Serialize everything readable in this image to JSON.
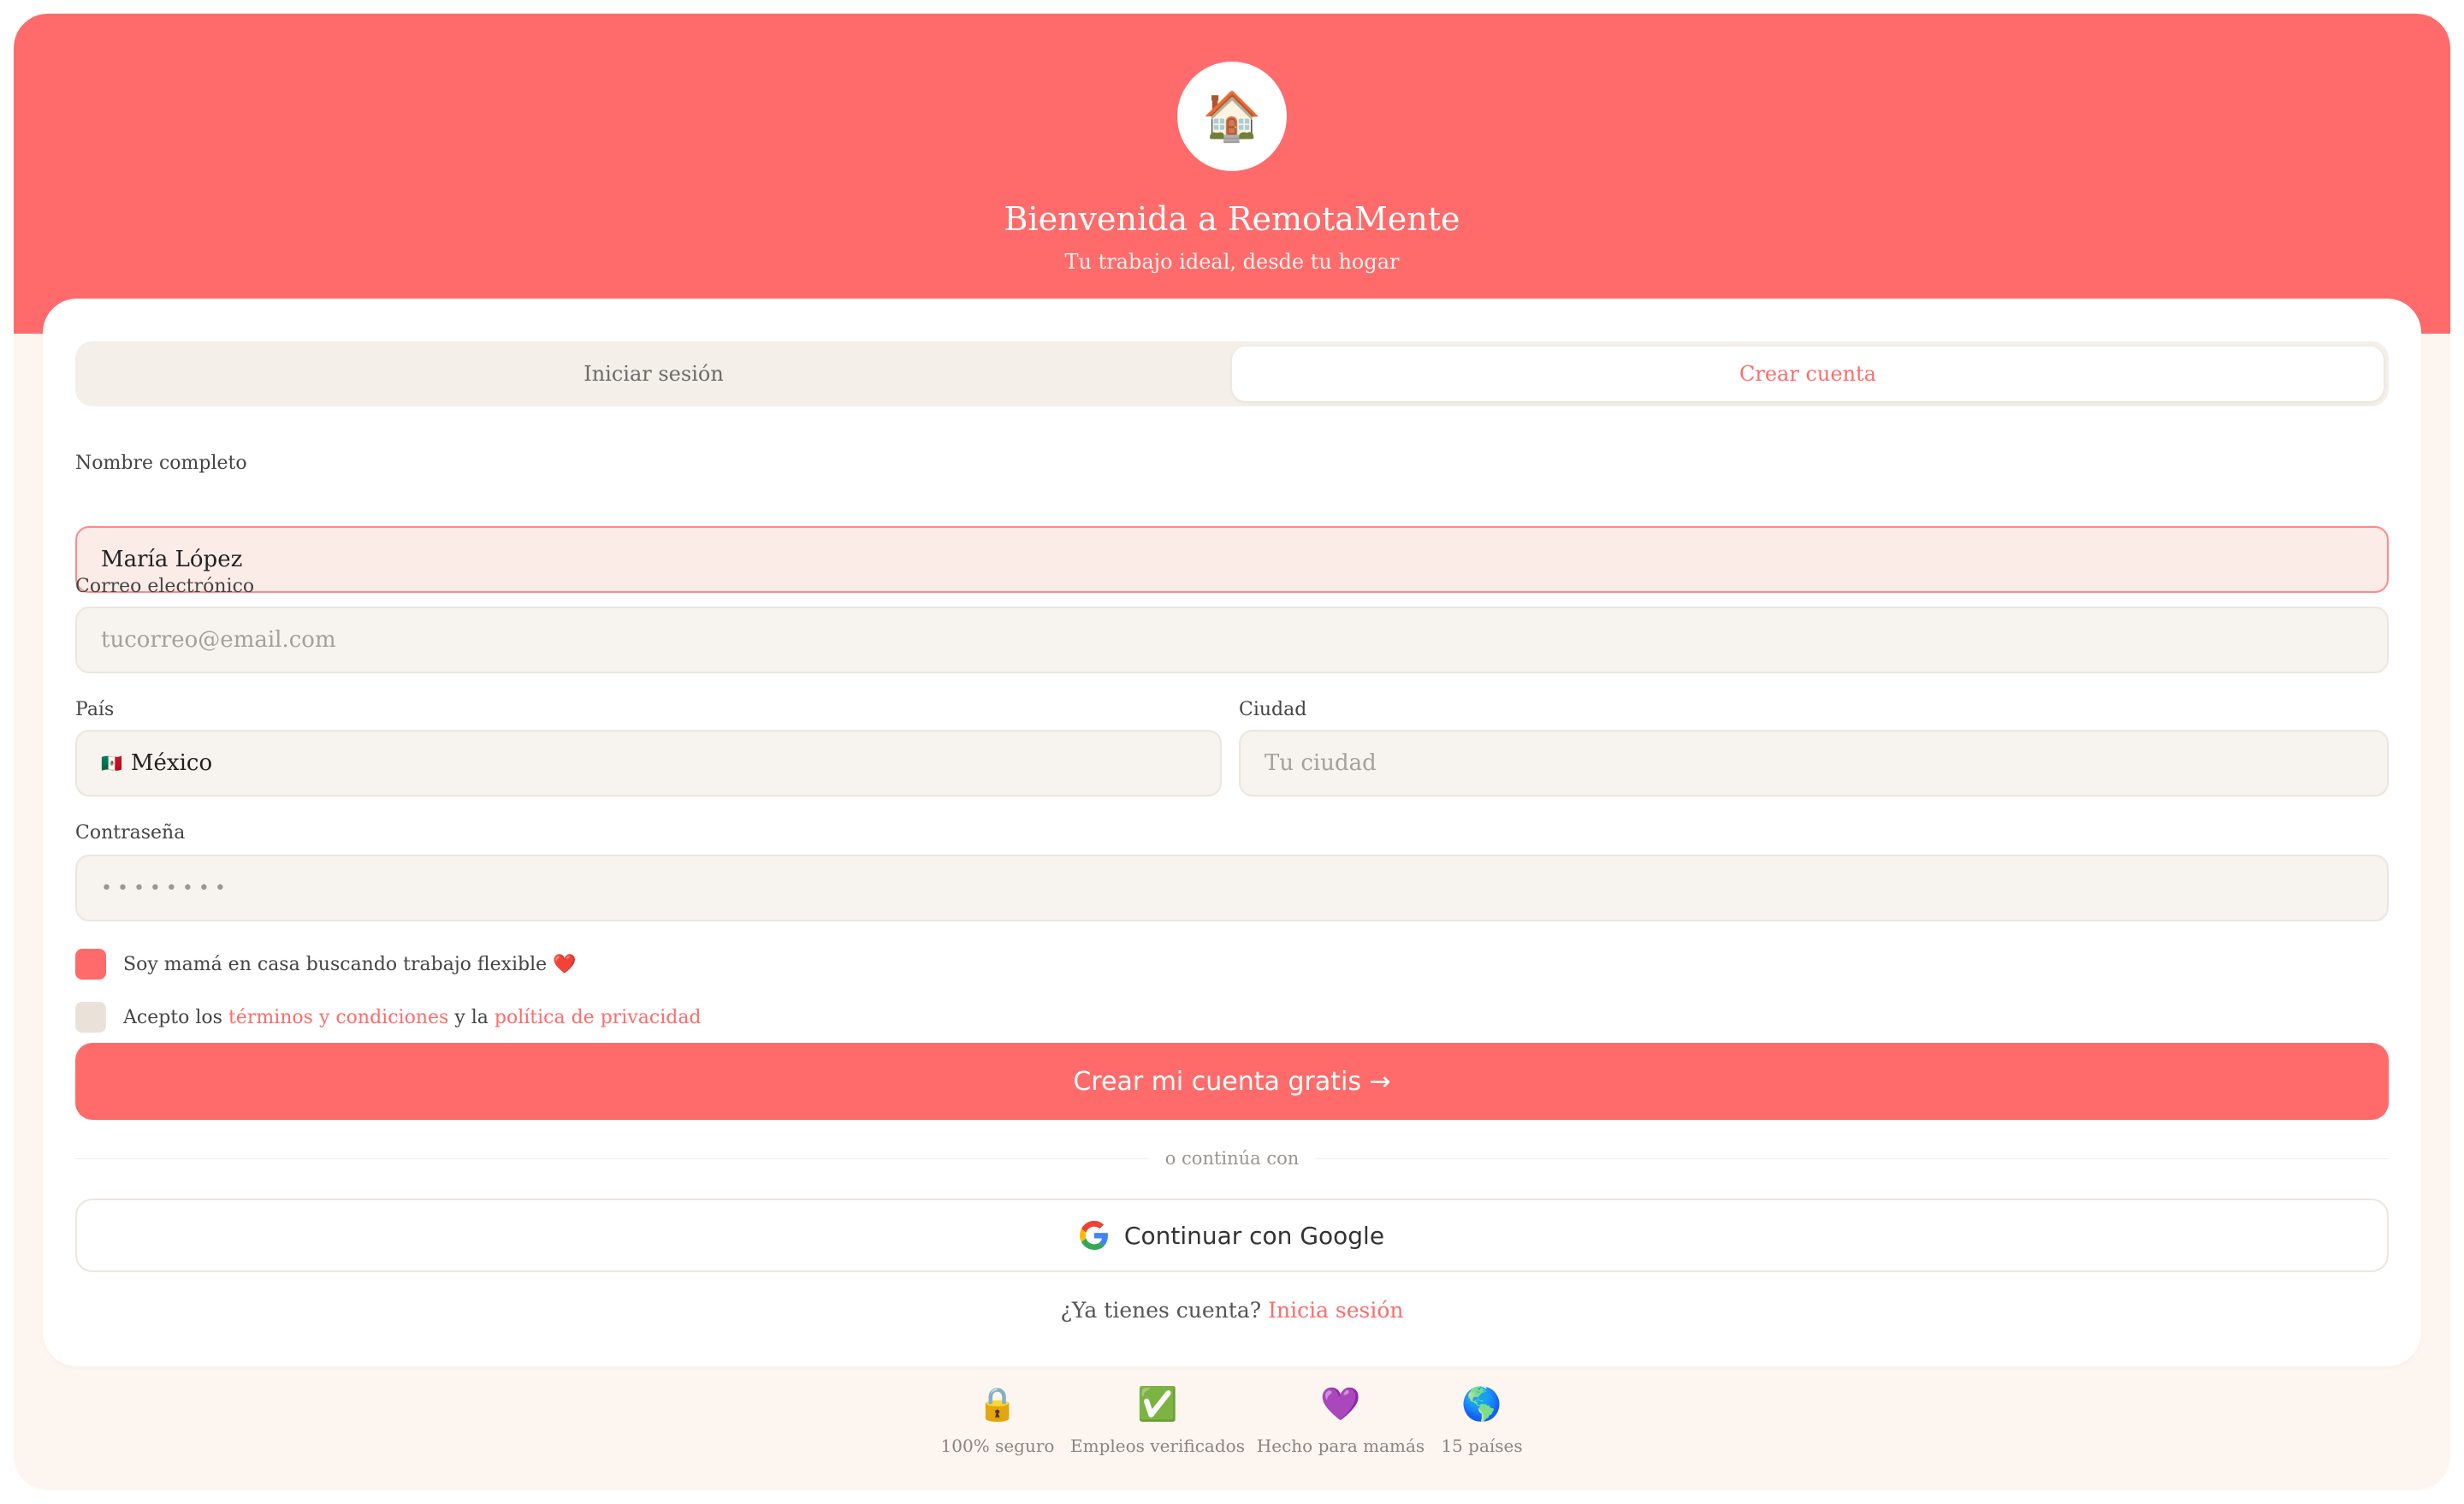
{
  "header": {
    "logo_icon": "🏠",
    "title": "Bienvenida a RemotaMente",
    "subtitle": "Tu trabajo ideal, desde tu hogar"
  },
  "tabs": [
    {
      "label": "Iniciar sesión",
      "active": false
    },
    {
      "label": "Crear cuenta",
      "active": true
    }
  ],
  "form": {
    "name": {
      "label": "Nombre completo",
      "value": "María López"
    },
    "email": {
      "label": "Correo electrónico",
      "placeholder": "tucorreo@email.com",
      "value": ""
    },
    "country": {
      "label": "País",
      "flag": "🇲🇽",
      "value": "México"
    },
    "city": {
      "label": "Ciudad",
      "placeholder": "Tu ciudad",
      "value": ""
    },
    "password": {
      "label": "Contraseña",
      "masked": "••••••••"
    },
    "mom_checkbox": {
      "label": "Soy mamá en casa buscando trabajo flexible ❤️",
      "checked": true
    },
    "terms_checkbox": {
      "prefix": "Acepto los",
      "terms_link": "términos y condiciones",
      "middle": "y la",
      "privacy_link": "política de privacidad",
      "checked": false
    },
    "submit_label": "Crear mi cuenta gratis →",
    "divider_text": "o continúa con",
    "google_label": "Continuar con Google",
    "have_account_text": "¿Ya tienes cuenta?",
    "signin_link": "Inicia sesión"
  },
  "features": [
    {
      "icon": "🔒",
      "label": "100% seguro"
    },
    {
      "icon": "✅",
      "label": "Empleos verificados"
    },
    {
      "icon": "💜",
      "label": "Hecho para mamás"
    },
    {
      "icon": "🌎",
      "label": "15 países"
    }
  ],
  "colors": {
    "accent": "#ff6b6b",
    "background": "#fdf6f0",
    "field_bg": "#f7f3ee",
    "active_field_bg": "#fcece8"
  }
}
